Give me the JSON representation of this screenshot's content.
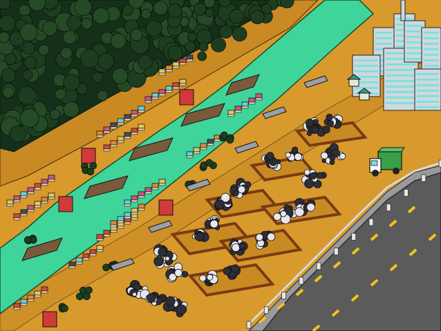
{
  "scene": {
    "description_colors": {
      "ground": "#d89a2c",
      "ground_dark": "#b77a1c",
      "forest": "#15301a",
      "forest_light": "#244a26",
      "river": "#3fd49a",
      "road": "#5b5b5b",
      "road_line": "#f2c21a",
      "guardrail": "#cfcfcf",
      "pit_frame": "#7a3a12",
      "garbage_dark": "#2e2e38",
      "garbage_light": "#e6e6ee",
      "building": "#cfd8dc",
      "building_window": "#7fe0e0",
      "truck_cab": "#ffffff",
      "truck_bed": "#3aa048"
    },
    "elements": [
      "forest",
      "river",
      "houses",
      "bridges",
      "drain-pipes",
      "garbage-pits",
      "garbage-piles",
      "city-buildings",
      "garbage-truck",
      "highway",
      "guardrail"
    ]
  }
}
